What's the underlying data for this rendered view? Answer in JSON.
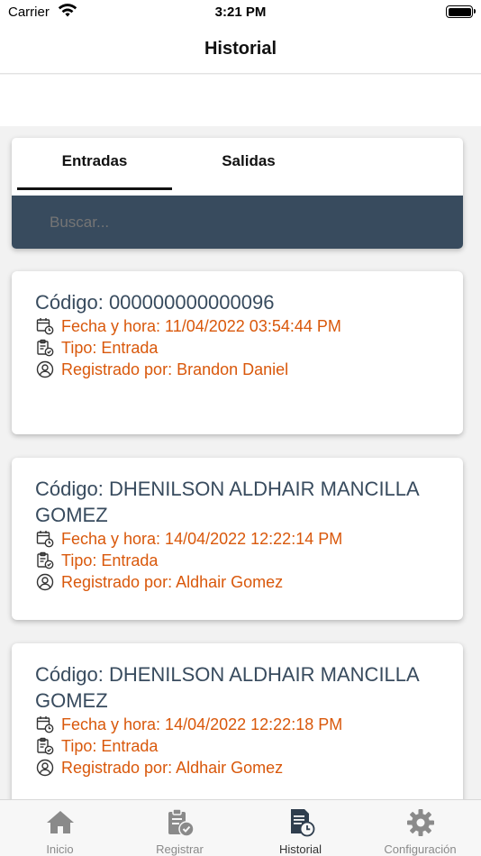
{
  "status_bar": {
    "carrier": "Carrier",
    "time": "3:21 PM"
  },
  "nav": {
    "title": "Historial"
  },
  "tabs": [
    {
      "label": "Entradas",
      "active": true
    },
    {
      "label": "Salidas",
      "active": false
    }
  ],
  "search": {
    "placeholder": "Buscar..."
  },
  "records": [
    {
      "code": "Código: 000000000000096",
      "datetime": "Fecha y hora: 11/04/2022 03:54:44 PM",
      "type": "Tipo: Entrada",
      "registered_by": "Registrado por: Brandon Daniel"
    },
    {
      "code": "Código: DHENILSON ALDHAIR MANCILLA GOMEZ",
      "datetime": "Fecha y hora: 14/04/2022 12:22:14 PM",
      "type": "Tipo: Entrada",
      "registered_by": "Registrado por: Aldhair Gomez"
    },
    {
      "code": "Código: DHENILSON ALDHAIR MANCILLA GOMEZ",
      "datetime": "Fecha y hora: 14/04/2022 12:22:18 PM",
      "type": "Tipo: Entrada",
      "registered_by": "Registrado por: Aldhair Gomez"
    }
  ],
  "tab_bar": [
    {
      "label": "Inicio",
      "icon": "home-icon"
    },
    {
      "label": "Registrar",
      "icon": "clipboard-check-icon"
    },
    {
      "label": "Historial",
      "icon": "history-document-icon",
      "active": true
    },
    {
      "label": "Configuración",
      "icon": "gear-icon"
    }
  ],
  "colors": {
    "accent_orange": "#d9580b",
    "slate": "#384b5e"
  }
}
